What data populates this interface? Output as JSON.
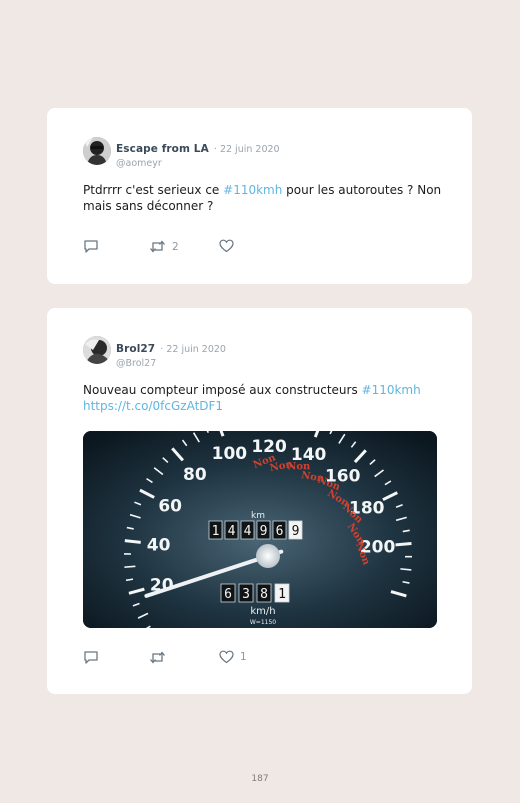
{
  "tweets": [
    {
      "author": "Escape from LA",
      "date": "· 22 juin 2020",
      "handle": "@aomeyr",
      "text_before": "Ptdrrrr c'est serieux ce ",
      "hashtag": "#110kmh",
      "text_after": " pour les autoroutes ? Non mais sans déconner ?",
      "retweets": "2",
      "likes": ""
    },
    {
      "author": "Brol27",
      "date": "· 22 juin 2020",
      "handle": "@Brol27",
      "text_before": "Nouveau compteur imposé aux constructeurs ",
      "hashtag": "#110kmh",
      "link": "https://t.co/0fcGzAtDF1",
      "retweets": "",
      "likes": "1"
    }
  ],
  "speedometer": {
    "labels": [
      "20",
      "40",
      "60",
      "80",
      "100",
      "120",
      "140",
      "160",
      "180",
      "200"
    ],
    "odometer": [
      "1",
      "4",
      "4",
      "9",
      "6",
      "9"
    ],
    "trip": [
      "6",
      "3",
      "8",
      "1"
    ],
    "unit_top": "km",
    "unit_bottom": "km/h",
    "model": "W=1150",
    "stamp": "Non",
    "needle_kmh": 17
  },
  "colors": {
    "link": "#5fb6e0",
    "author": "#3b4a5a",
    "stamp": "#d2402e"
  },
  "page_number": "187"
}
